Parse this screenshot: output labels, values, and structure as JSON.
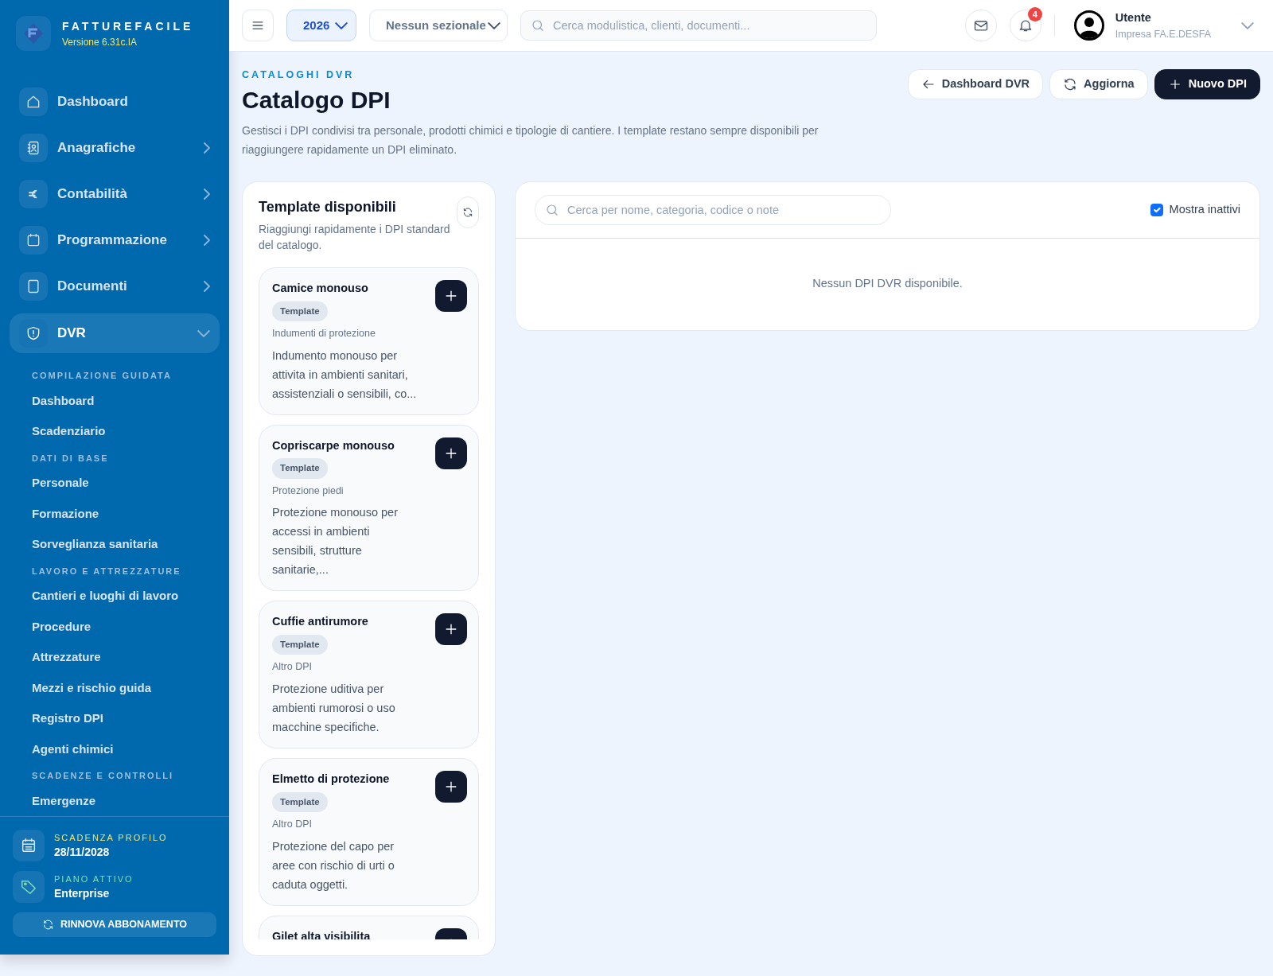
{
  "sidebar": {
    "brand": "FATTUREFACILE",
    "version": "Versione 6.31c.IA",
    "nav": [
      {
        "label": "Dashboard",
        "expandable": false,
        "selected": false
      },
      {
        "label": "Anagrafiche",
        "expandable": true,
        "expanded": false,
        "selected": false
      },
      {
        "label": "Contabilità",
        "expandable": true,
        "expanded": false,
        "selected": false
      },
      {
        "label": "Programmazione",
        "expandable": true,
        "expanded": false,
        "selected": false
      },
      {
        "label": "Documenti",
        "expandable": true,
        "expanded": false,
        "selected": false
      },
      {
        "label": "DVR",
        "expandable": true,
        "expanded": true,
        "selected": true
      }
    ],
    "sections": [
      {
        "heading": "COMPILAZIONE GUIDATA",
        "items": [
          "Dashboard",
          "Scadenziario"
        ]
      },
      {
        "heading": "DATI DI BASE",
        "items": [
          "Personale",
          "Formazione",
          "Sorveglianza sanitaria"
        ]
      },
      {
        "heading": "LAVORO E ATTREZZATURE",
        "items": [
          "Cantieri e luoghi di lavoro",
          "Procedure",
          "Attrezzature",
          "Mezzi e rischio guida",
          "Registro DPI",
          "Agenti chimici"
        ]
      },
      {
        "heading": "SCADENZE E CONTROLLI",
        "items": [
          "Emergenze"
        ]
      }
    ],
    "footer": {
      "expiry_label": "SCADENZA PROFILO",
      "expiry": "28/11/2028",
      "plan_label": "PIANO ATTIVO",
      "plan": "Enterprise",
      "renew_button": "RINNOVA ABBONAMENTO"
    }
  },
  "topbar": {
    "year": "2026",
    "sezionale": "Nessun sezionale",
    "search_placeholder": "Cerca modulistica, clienti, documenti...",
    "notifications": "4",
    "user": {
      "name": "Utente",
      "company": "Impresa FA.E.DESFA"
    }
  },
  "page": {
    "eyebrow": "CATALOGHI DVR",
    "title": "Catalogo DPI",
    "description": "Gestisci i DPI condivisi tra personale, prodotti chimici e tipologie di cantiere. I template restano sempre disponibili per riaggiungere rapidamente un DPI eliminato.",
    "actions": [
      {
        "label": "Dashboard DVR",
        "kind": "back"
      },
      {
        "label": "Aggiorna",
        "kind": "refresh"
      },
      {
        "label": "Nuovo DPI",
        "kind": "primary"
      }
    ]
  },
  "templates": {
    "title": "Template disponibili",
    "subtitle": "Riaggiungi rapidamente i DPI standard del catalogo.",
    "items": [
      {
        "name": "Camice monouso",
        "badge": "Template",
        "category": "Indumenti di protezione",
        "description": "Indumento monouso per attivita in ambienti sanitari, assistenziali o sensibili, co..."
      },
      {
        "name": "Copriscarpe monouso",
        "badge": "Template",
        "category": "Protezione piedi",
        "description": "Protezione monouso per accessi in ambienti sensibili, strutture sanitarie,..."
      },
      {
        "name": "Cuffie antirumore",
        "badge": "Template",
        "category": "Altro DPI",
        "description": "Protezione uditiva per ambienti rumorosi o uso macchine specifiche."
      },
      {
        "name": "Elmetto di protezione",
        "badge": "Template",
        "category": "Altro DPI",
        "description": "Protezione del capo per aree con rischio di urti o caduta oggetti."
      },
      {
        "name": "Gilet alta visibilita"
      }
    ]
  },
  "catalog": {
    "search_placeholder": "Cerca per nome, categoria, codice o note",
    "show_inactive": {
      "label": "Mostra inattivi",
      "checked": true
    },
    "empty": "Nessun DPI DVR disponibile."
  }
}
